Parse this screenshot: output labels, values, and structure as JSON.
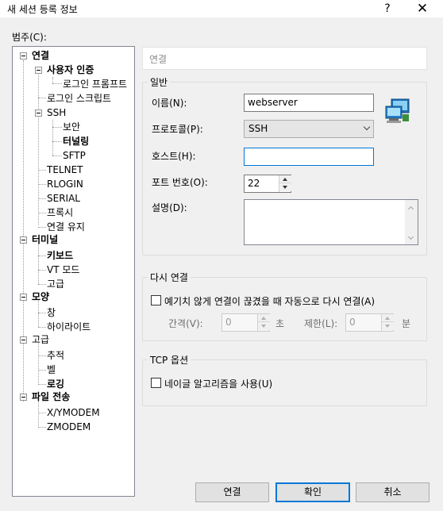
{
  "window": {
    "title": "새 세션 등록 정보",
    "help": "?",
    "close": "✕"
  },
  "category_label": "범주(C):",
  "tree": {
    "connection": "연결",
    "user_auth": "사용자 인증",
    "login_prompt": "로그인 프롬프트",
    "login_script": "로그인 스크립트",
    "ssh": "SSH",
    "security": "보안",
    "tunneling": "터널링",
    "sftp": "SFTP",
    "telnet": "TELNET",
    "rlogin": "RLOGIN",
    "serial": "SERIAL",
    "proxy": "프록시",
    "keepalive": "연결 유지",
    "terminal": "터미널",
    "keyboard": "키보드",
    "vt_mode": "VT 모드",
    "advanced_term": "고급",
    "appearance": "모양",
    "window": "창",
    "highlight": "하이라이트",
    "advanced": "고급",
    "trace": "추적",
    "bell": "벨",
    "logging": "로깅",
    "file_transfer": "파일 전송",
    "xymodem": "X/YMODEM",
    "zmodem": "ZMODEM"
  },
  "panel_header": "연결",
  "general": {
    "title": "일반",
    "name_label": "이름(N):",
    "name_value": "webserver",
    "protocol_label": "프로토콜(P):",
    "protocol_value": "SSH",
    "host_label": "호스트(H):",
    "host_value": "",
    "port_label": "포트 번호(O):",
    "port_value": "22",
    "desc_label": "설명(D):",
    "desc_value": ""
  },
  "reconnect": {
    "title": "다시 연결",
    "auto_label": "예기치 않게 연결이 끊겼을 때 자동으로 다시 연결(A)",
    "interval_label": "간격(V):",
    "interval_value": "0",
    "interval_unit": "초",
    "limit_label": "제한(L):",
    "limit_value": "0",
    "limit_unit": "분"
  },
  "tcp": {
    "title": "TCP 옵션",
    "nagle_label": "네이글 알고리즘을 사용(U)"
  },
  "buttons": {
    "connect": "연결",
    "ok": "확인",
    "cancel": "취소"
  },
  "colors": {
    "focus_blue": "#0078d7",
    "tree_border": "#828790",
    "dialog_bg": "#f0f0f0"
  }
}
